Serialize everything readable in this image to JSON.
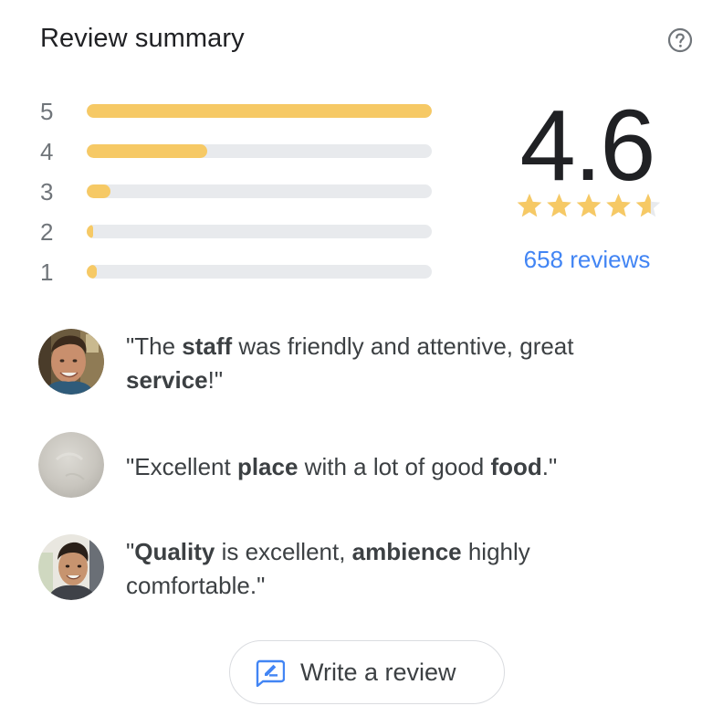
{
  "header": {
    "title": "Review summary",
    "help_icon": "help-circle-icon"
  },
  "rating_distribution": [
    {
      "stars": "5",
      "fraction": 1.0
    },
    {
      "stars": "4",
      "fraction": 0.35
    },
    {
      "stars": "3",
      "fraction": 0.07
    },
    {
      "stars": "2",
      "fraction": 0.015
    },
    {
      "stars": "1",
      "fraction": 0.03
    }
  ],
  "summary": {
    "average": "4.6",
    "star_rating": 4.6,
    "star_max": 5,
    "reviews_link": "658 reviews"
  },
  "snippets": [
    {
      "avatar": "reviewer-photo",
      "parts": [
        {
          "text": "\"The ",
          "bold": false
        },
        {
          "text": "staff",
          "bold": true
        },
        {
          "text": " was friendly and attentive, great ",
          "bold": false
        },
        {
          "text": "service",
          "bold": true
        },
        {
          "text": "!\"",
          "bold": false
        }
      ]
    },
    {
      "avatar": "reviewer-photo-blank",
      "parts": [
        {
          "text": "\"Excellent ",
          "bold": false
        },
        {
          "text": "place",
          "bold": true
        },
        {
          "text": " with a lot of good ",
          "bold": false
        },
        {
          "text": "food",
          "bold": true
        },
        {
          "text": ".\"",
          "bold": false
        }
      ]
    },
    {
      "avatar": "reviewer-photo",
      "parts": [
        {
          "text": "\"",
          "bold": false
        },
        {
          "text": "Quality",
          "bold": true
        },
        {
          "text": " is excellent, ",
          "bold": false
        },
        {
          "text": "ambience",
          "bold": true
        },
        {
          "text": " highly comfortable.\"",
          "bold": false
        }
      ]
    }
  ],
  "write_review": {
    "label": "Write a review",
    "icon": "rate-review-icon"
  },
  "colors": {
    "bar_fill": "#f6c965",
    "bar_track": "#e8eaed",
    "star_filled": "#f6c965",
    "star_empty": "#e8eaed",
    "link": "#4285f4",
    "icon_blue": "#4285f4"
  }
}
